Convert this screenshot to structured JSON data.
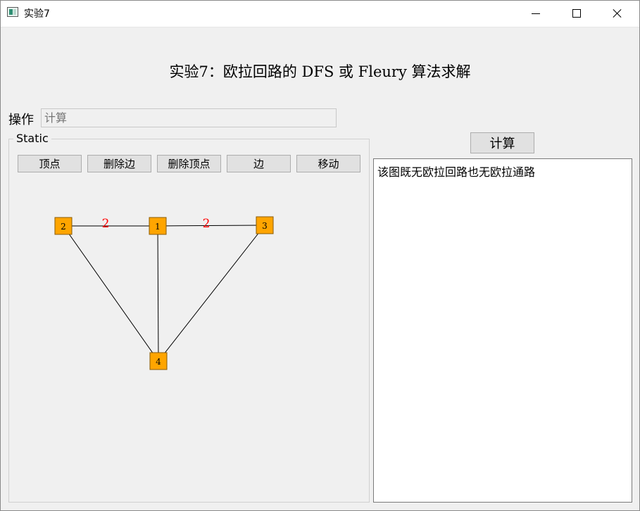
{
  "window": {
    "title": "实验7"
  },
  "heading": "实验7：欧拉回路的 DFS 或 Fleury 算法求解",
  "operation": {
    "label": "操作",
    "value": "",
    "placeholder": "计算"
  },
  "group": {
    "title": "Static",
    "tools": [
      "顶点",
      "删除边",
      "删除顶点",
      "边",
      "移动"
    ]
  },
  "graph": {
    "nodes": [
      {
        "id": "node-1",
        "label": "1"
      },
      {
        "id": "node-2",
        "label": "2"
      },
      {
        "id": "node-3",
        "label": "3"
      },
      {
        "id": "node-4",
        "label": "4"
      }
    ],
    "edges": [
      {
        "from": "1",
        "to": "2",
        "weight": "2"
      },
      {
        "from": "1",
        "to": "3",
        "weight": "2"
      },
      {
        "from": "1",
        "to": "4",
        "weight": ""
      },
      {
        "from": "2",
        "to": "4",
        "weight": ""
      },
      {
        "from": "3",
        "to": "4",
        "weight": ""
      }
    ],
    "colors": {
      "node_fill": "#ffa500",
      "node_border": "#8a5a00",
      "edge": "#000000",
      "weight": "#ff0000"
    }
  },
  "calculate_label": "计算",
  "output": {
    "text": "该图既无欧拉回路也无欧拉通路"
  },
  "icons": {
    "app": "app-window-icon",
    "minimize": "minimize-icon",
    "maximize": "maximize-icon",
    "close": "close-icon"
  }
}
